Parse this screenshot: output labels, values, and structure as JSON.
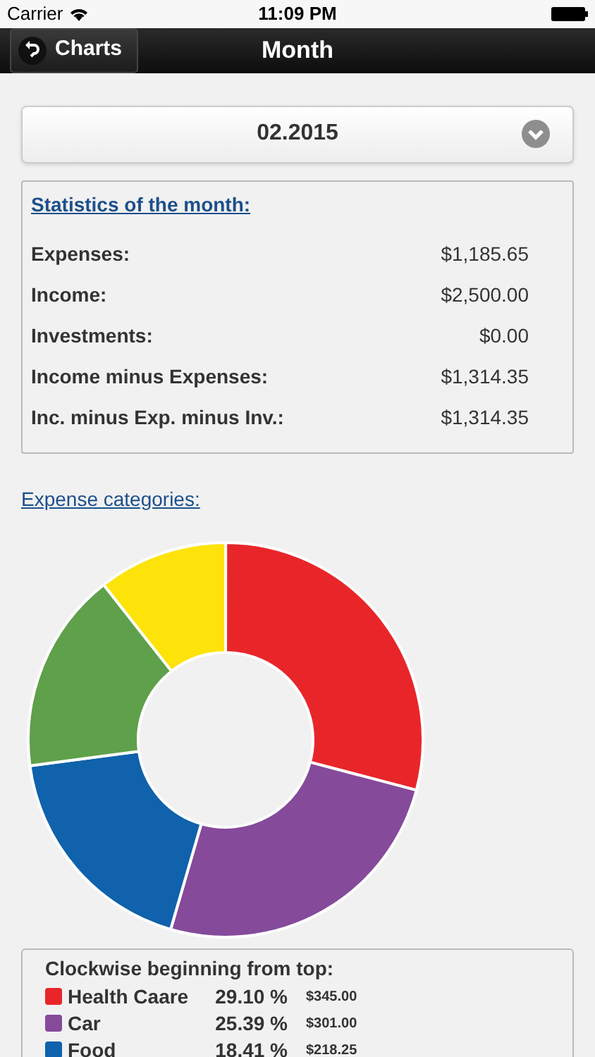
{
  "status_bar": {
    "carrier": "Carrier",
    "time": "11:09 PM"
  },
  "nav_bar": {
    "back_button": "Charts",
    "title": "Month"
  },
  "month_select": {
    "value": "02.2015"
  },
  "statistics": {
    "title": "Statistics of the month:",
    "rows": [
      {
        "label": "Expenses:",
        "value": "$1,185.65"
      },
      {
        "label": "Income:",
        "value": "$2,500.00"
      },
      {
        "label": "Investments:",
        "value": "$0.00"
      },
      {
        "label": "Income minus Expenses:",
        "value": "$1,314.35"
      },
      {
        "label": "Inc. minus Exp. minus Inv.:",
        "value": "$1,314.35"
      }
    ]
  },
  "expense_categories_link": "Expense categories:",
  "legend": {
    "title": "Clockwise beginning from top:",
    "items": [
      {
        "name": "Health Caare",
        "percent": "29.10 %",
        "amount": "$345.00",
        "color": "#e8262a"
      },
      {
        "name": "Car",
        "percent": "25.39 %",
        "amount": "$301.00",
        "color": "#854a9a"
      },
      {
        "name": "Food",
        "percent": "18.41 %",
        "amount": "$218.25",
        "color": "#0f62ab"
      }
    ]
  }
}
